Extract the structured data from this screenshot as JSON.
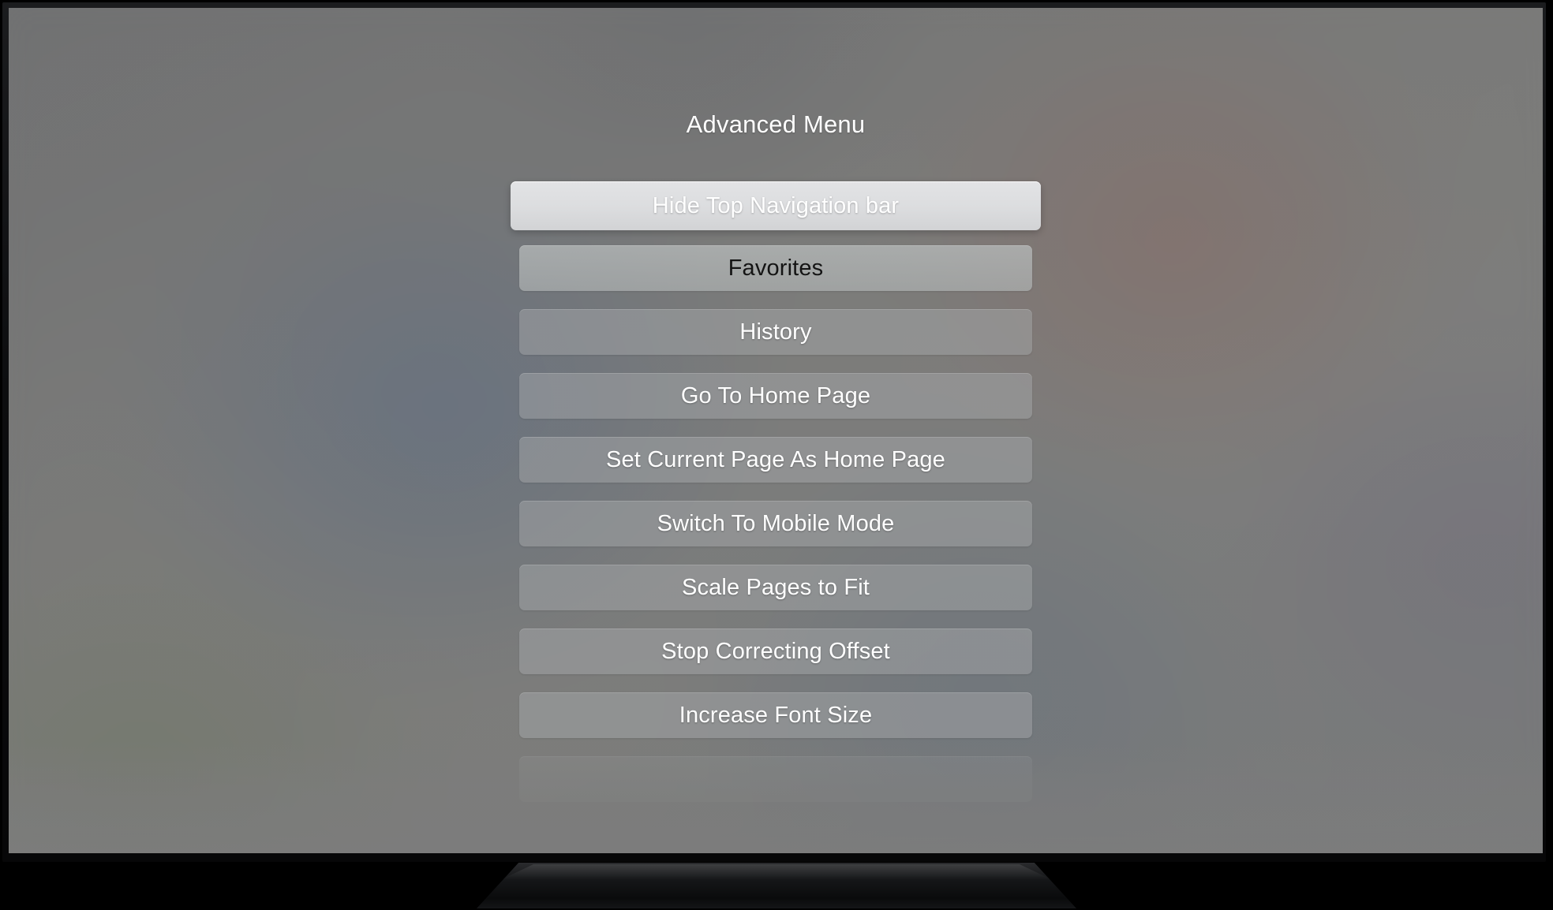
{
  "device": {
    "type": "television",
    "bezel_color": "#0c0d0f",
    "screen_background_color": "#7c7c7c"
  },
  "screen": {
    "title": "Advanced Menu",
    "title_color": "#ffffff",
    "focused_index": 0,
    "items": [
      {
        "label": "Hide Top Navigation bar",
        "state": "focused",
        "text_color": "#ffffff",
        "background_color": "#dcdddf"
      },
      {
        "label": "Favorites",
        "state": "normal",
        "text_color": "#141414",
        "background_color": "#b2b6b6"
      },
      {
        "label": "History",
        "state": "normal",
        "text_color": "#ffffff",
        "background_color": "#a0a3a5"
      },
      {
        "label": "Go To Home Page",
        "state": "normal",
        "text_color": "#ffffff",
        "background_color": "#a0a3a5"
      },
      {
        "label": "Set Current Page As Home Page",
        "state": "normal",
        "text_color": "#ffffff",
        "background_color": "#a0a3a5"
      },
      {
        "label": "Switch To Mobile Mode",
        "state": "normal",
        "text_color": "#ffffff",
        "background_color": "#a0a3a5"
      },
      {
        "label": "Scale Pages to Fit",
        "state": "normal",
        "text_color": "#ffffff",
        "background_color": "#a0a3a5"
      },
      {
        "label": "Stop Correcting Offset",
        "state": "normal",
        "text_color": "#ffffff",
        "background_color": "#a0a3a5"
      },
      {
        "label": "Increase Font Size",
        "state": "normal",
        "text_color": "#ffffff",
        "background_color": "#a0a3a5"
      },
      {
        "label": "",
        "state": "ghost",
        "text_color": "#ffffff",
        "background_color": "#a0a3a5"
      }
    ]
  }
}
